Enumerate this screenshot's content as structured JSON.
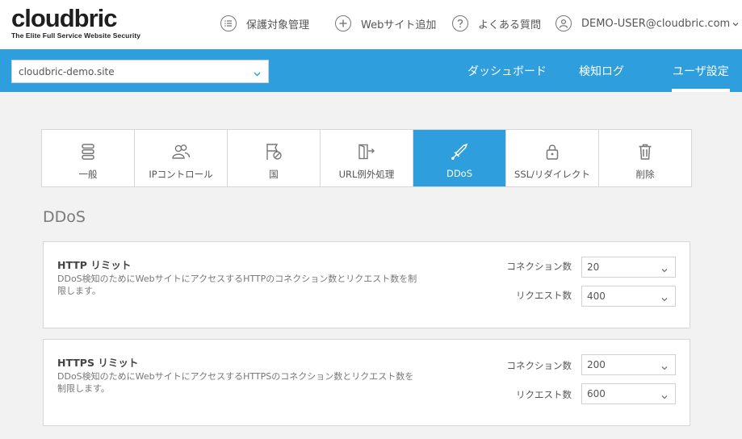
{
  "header": {
    "logo_text": "cloudbric",
    "logo_tagline": "The Elite Full Service Website Security",
    "nav": [
      {
        "label": "保護対象管理",
        "icon": "list-icon"
      },
      {
        "label": "Webサイト追加",
        "icon": "plus-icon"
      },
      {
        "label": "よくある質問",
        "icon": "question-icon"
      },
      {
        "label": "DEMO-USER@cloudbric.com",
        "icon": "user-icon"
      }
    ]
  },
  "site_selector": {
    "value": "cloudbric-demo.site"
  },
  "main_nav": [
    {
      "label": "ダッシュボード",
      "active": false
    },
    {
      "label": "検知ログ",
      "active": false
    },
    {
      "label": "ユーザ設定",
      "active": true
    }
  ],
  "tabs": [
    {
      "label": "一般",
      "icon": "server-stack-icon"
    },
    {
      "label": "IPコントロール",
      "icon": "users-icon"
    },
    {
      "label": "国",
      "icon": "flag-block-icon"
    },
    {
      "label": "URL例外処理",
      "icon": "exit-door-icon"
    },
    {
      "label": "DDoS",
      "icon": "sword-icon",
      "active": true
    },
    {
      "label": "SSL/リダイレクト",
      "icon": "lock-icon"
    },
    {
      "label": "削除",
      "icon": "trash-icon"
    }
  ],
  "section_title": "DDoS",
  "cards": [
    {
      "title": "HTTP リミット",
      "description": "DDoS検知のためにWebサイトにアクセスするHTTPのコネクション数とリクエスト数を制限します。",
      "connection_label": "コネクション数",
      "connection_value": "20",
      "request_label": "リクエスト数",
      "request_value": "400"
    },
    {
      "title": "HTTPS リミット",
      "description": "DDoS検知のためにWebサイトにアクセスするHTTPSのコネクション数とリクエスト数を制限します。",
      "connection_label": "コネクション数",
      "connection_value": "200",
      "request_label": "リクエスト数",
      "request_value": "600"
    }
  ],
  "colors": {
    "accent": "#2e9fdc",
    "background": "#f2f2f2"
  }
}
